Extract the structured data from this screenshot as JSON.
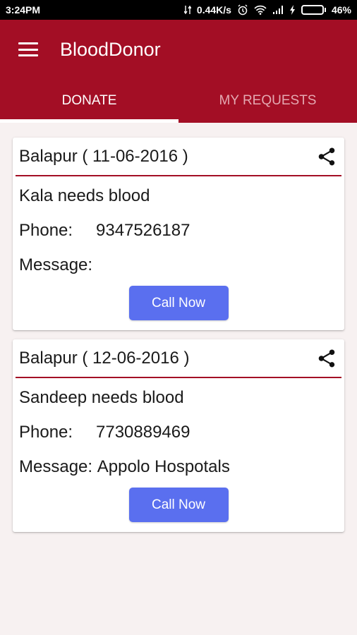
{
  "status_bar": {
    "time": "3:24PM",
    "network_speed": "0.44K/s",
    "battery_percent": "46%",
    "battery_level": 0.46,
    "icons": [
      "alarm-icon",
      "wifi-icon",
      "signal-icon",
      "charging-icon",
      "battery-icon"
    ]
  },
  "app": {
    "title": "BloodDonor",
    "accent_color": "#a30e25",
    "button_color": "#5a6fef"
  },
  "tabs": [
    {
      "label": "DONATE",
      "active": true
    },
    {
      "label": "MY REQUESTS",
      "active": false
    }
  ],
  "requests": [
    {
      "title": "Balapur ( 11-06-2016 )",
      "needs": "Kala needs  blood",
      "phone_label": "Phone:",
      "phone": "9347526187",
      "message_label": "Message:",
      "message": "",
      "button": "Call Now"
    },
    {
      "title": "Balapur ( 12-06-2016 )",
      "needs": "Sandeep needs  blood",
      "phone_label": "Phone:",
      "phone": "7730889469",
      "message_label": "Message:",
      "message": "Appolo Hospotals",
      "button": "Call Now"
    }
  ]
}
